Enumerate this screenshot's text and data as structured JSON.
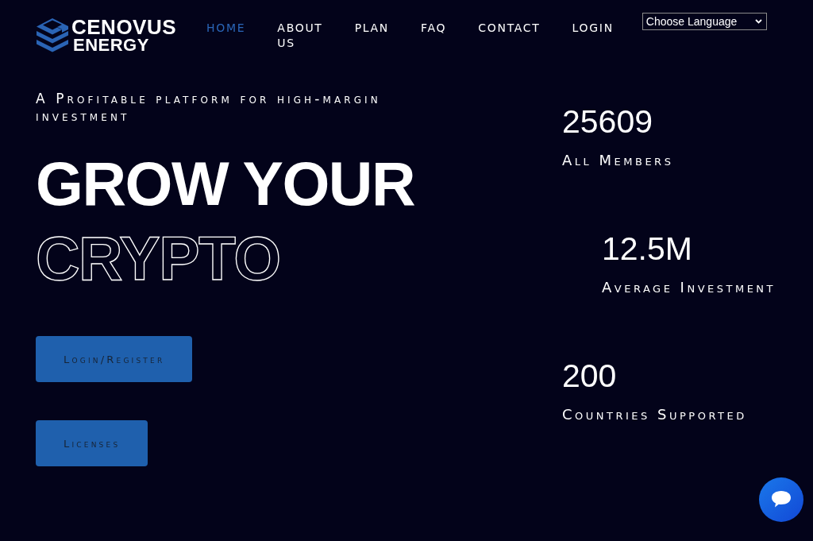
{
  "logo": {
    "name_lines": [
      "CENOVUS",
      "ENERGY"
    ]
  },
  "nav": {
    "items": [
      {
        "label": "HOME",
        "selected": true
      },
      {
        "label": "ABOUT US",
        "selected": false
      },
      {
        "label": "PLAN",
        "selected": false
      },
      {
        "label": "FAQ",
        "selected": false
      },
      {
        "label": "CONTACT",
        "selected": false
      },
      {
        "label": "LOGIN",
        "selected": false
      }
    ]
  },
  "language_select": {
    "value": "Choose Language"
  },
  "hero": {
    "tagline": "A Profitable platform for high-margin investment",
    "headline_lines": [
      {
        "text": "GROW YOUR",
        "kind": "solid"
      },
      {
        "text": "CRYPTO",
        "kind": "outline"
      }
    ],
    "buttons": [
      "Login/Register",
      "Licenses"
    ]
  },
  "stats": [
    {
      "value": "25609",
      "label": "All Members"
    },
    {
      "value": "12.5M",
      "label": "Average Investment"
    },
    {
      "value": "200",
      "label": "Countries Supported"
    }
  ]
}
